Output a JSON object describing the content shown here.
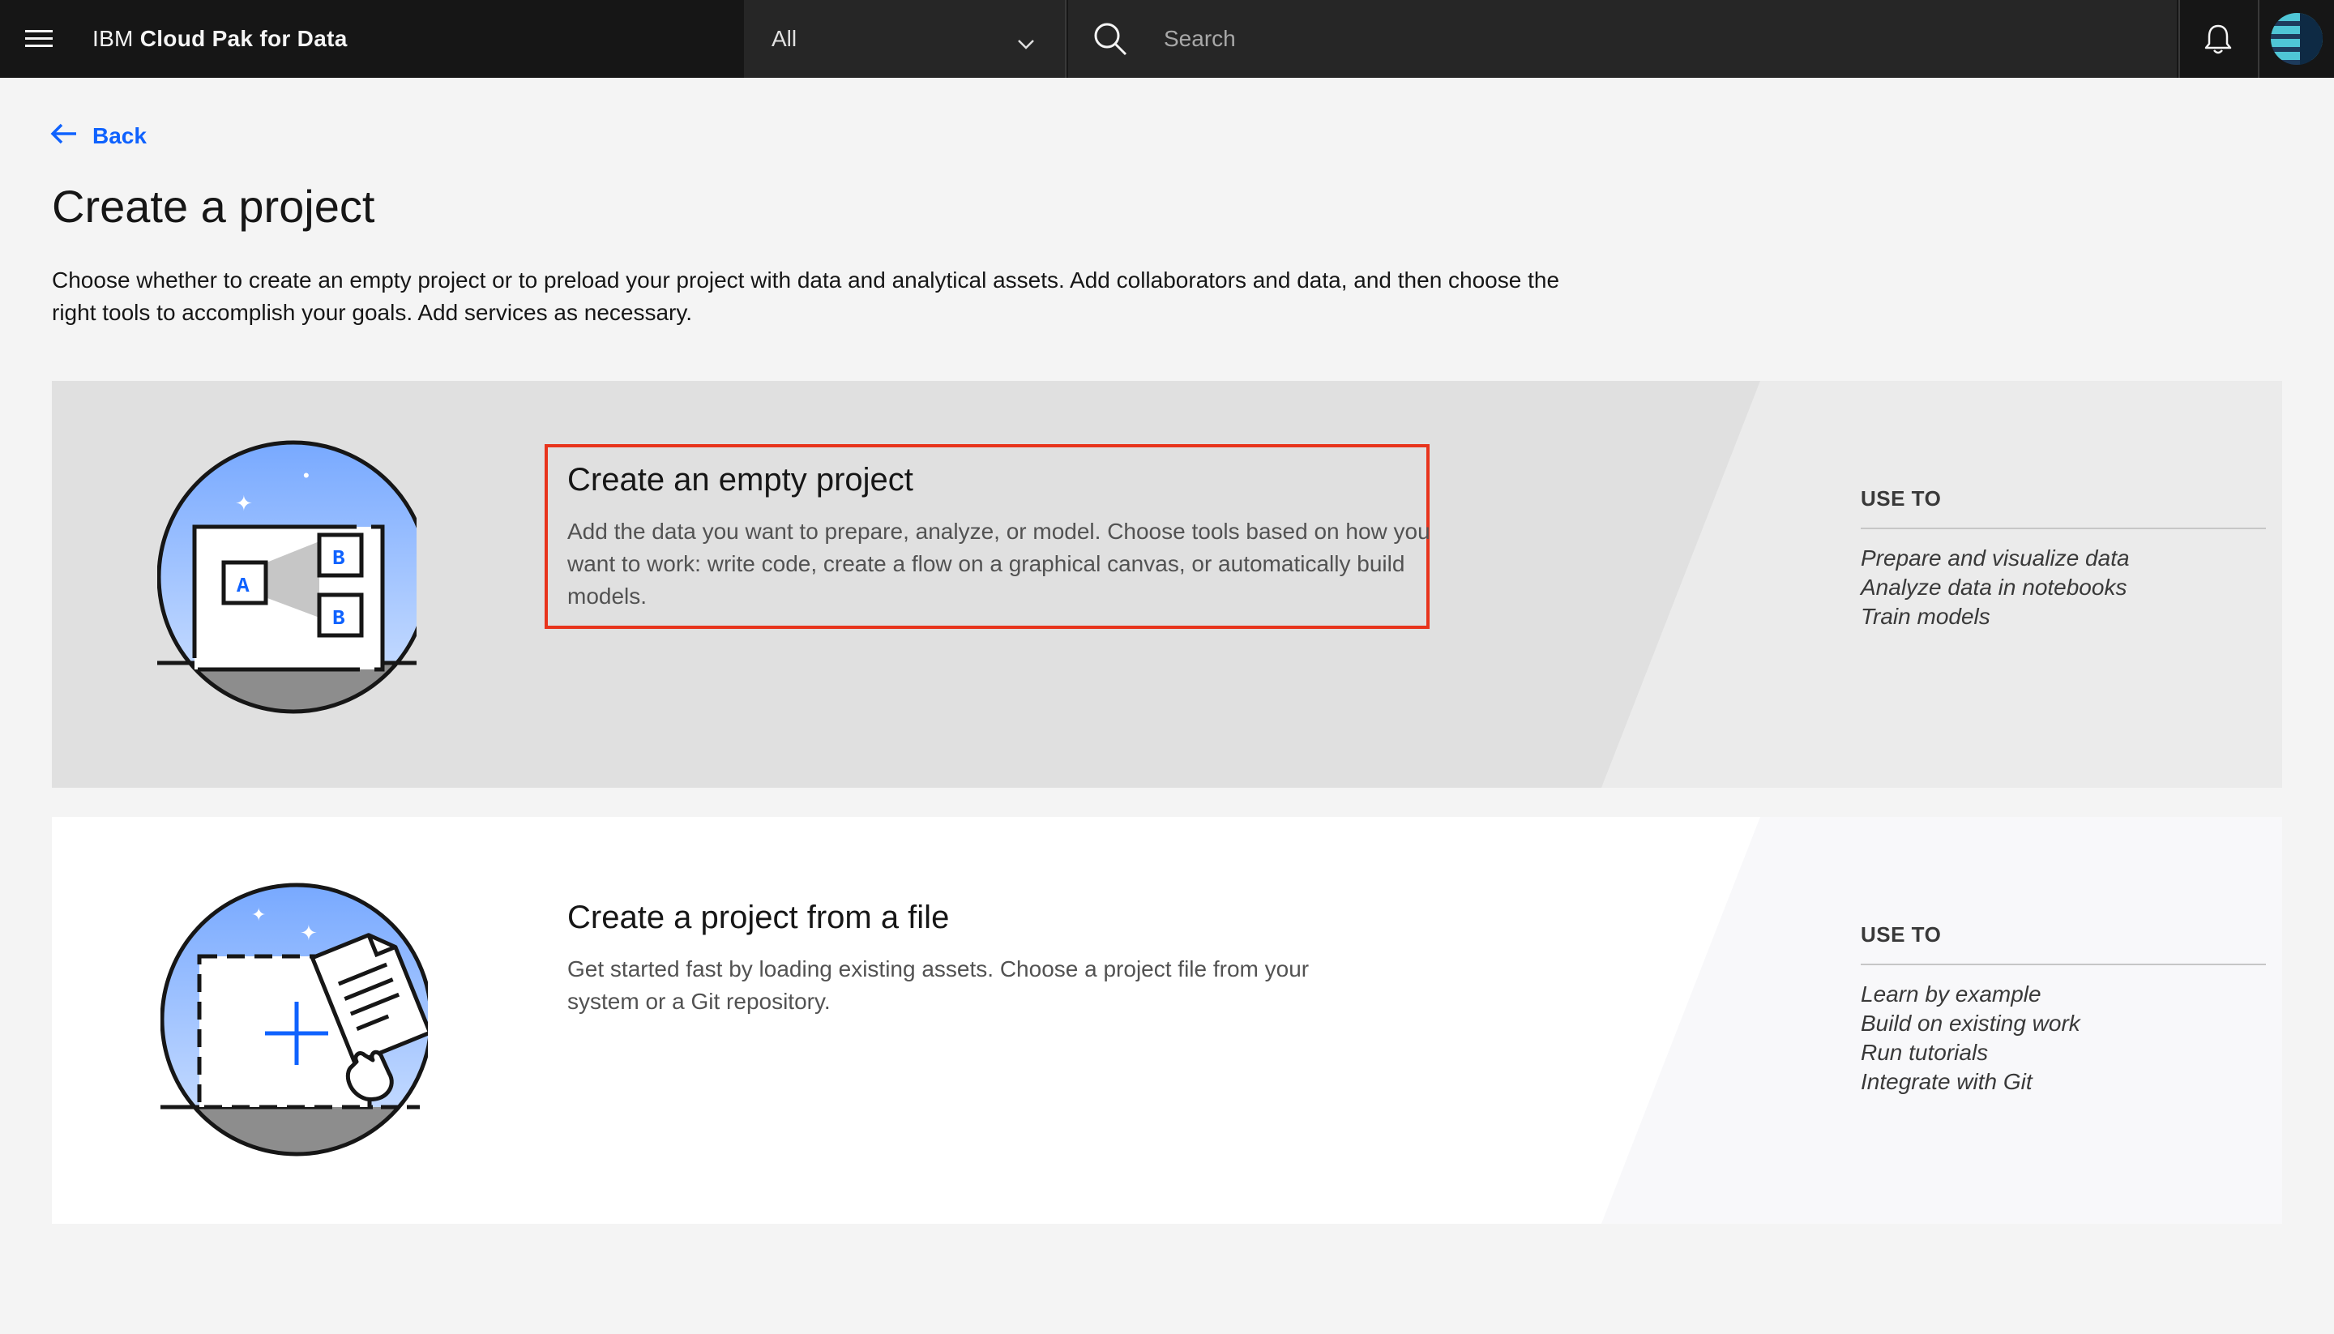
{
  "header": {
    "brand_prefix": "IBM",
    "brand_name": "Cloud Pak for Data",
    "scope_value": "All",
    "search_placeholder": "Search"
  },
  "nav": {
    "back_label": "Back"
  },
  "page": {
    "title": "Create a project",
    "description": "Choose whether to create an empty project or to preload your project with data and analytical assets. Add collaborators and data, and then choose the right tools to accomplish your goals. Add services as necessary."
  },
  "cards": [
    {
      "title": "Create an empty project",
      "description": "Add the data you want to prepare, analyze, or model. Choose tools based on how you want to work: write code, create a flow on a graphical canvas, or automatically build models.",
      "use_to_heading": "USE TO",
      "use_to_items": [
        "Prepare and visualize data",
        "Analyze data in notebooks",
        "Train models"
      ],
      "highlighted": true,
      "illustration_labels": [
        "A",
        "B",
        "B"
      ]
    },
    {
      "title": "Create a project from a file",
      "description": "Get started fast by loading existing assets. Choose a project file from your system or a Git repository.",
      "use_to_heading": "USE TO",
      "use_to_items": [
        "Learn by example",
        "Build on existing work",
        "Run tutorials",
        "Integrate with Git"
      ],
      "highlighted": false
    }
  ],
  "colors": {
    "header_bg": "#161616",
    "link_blue": "#0f62fe",
    "highlight_red": "#e8341c",
    "card_selected_bg": "#e0e0e0",
    "page_bg": "#f4f4f4"
  },
  "icons": [
    "hamburger-menu-icon",
    "chevron-down-icon",
    "search-icon",
    "notification-bell-icon",
    "arrow-left-icon"
  ]
}
